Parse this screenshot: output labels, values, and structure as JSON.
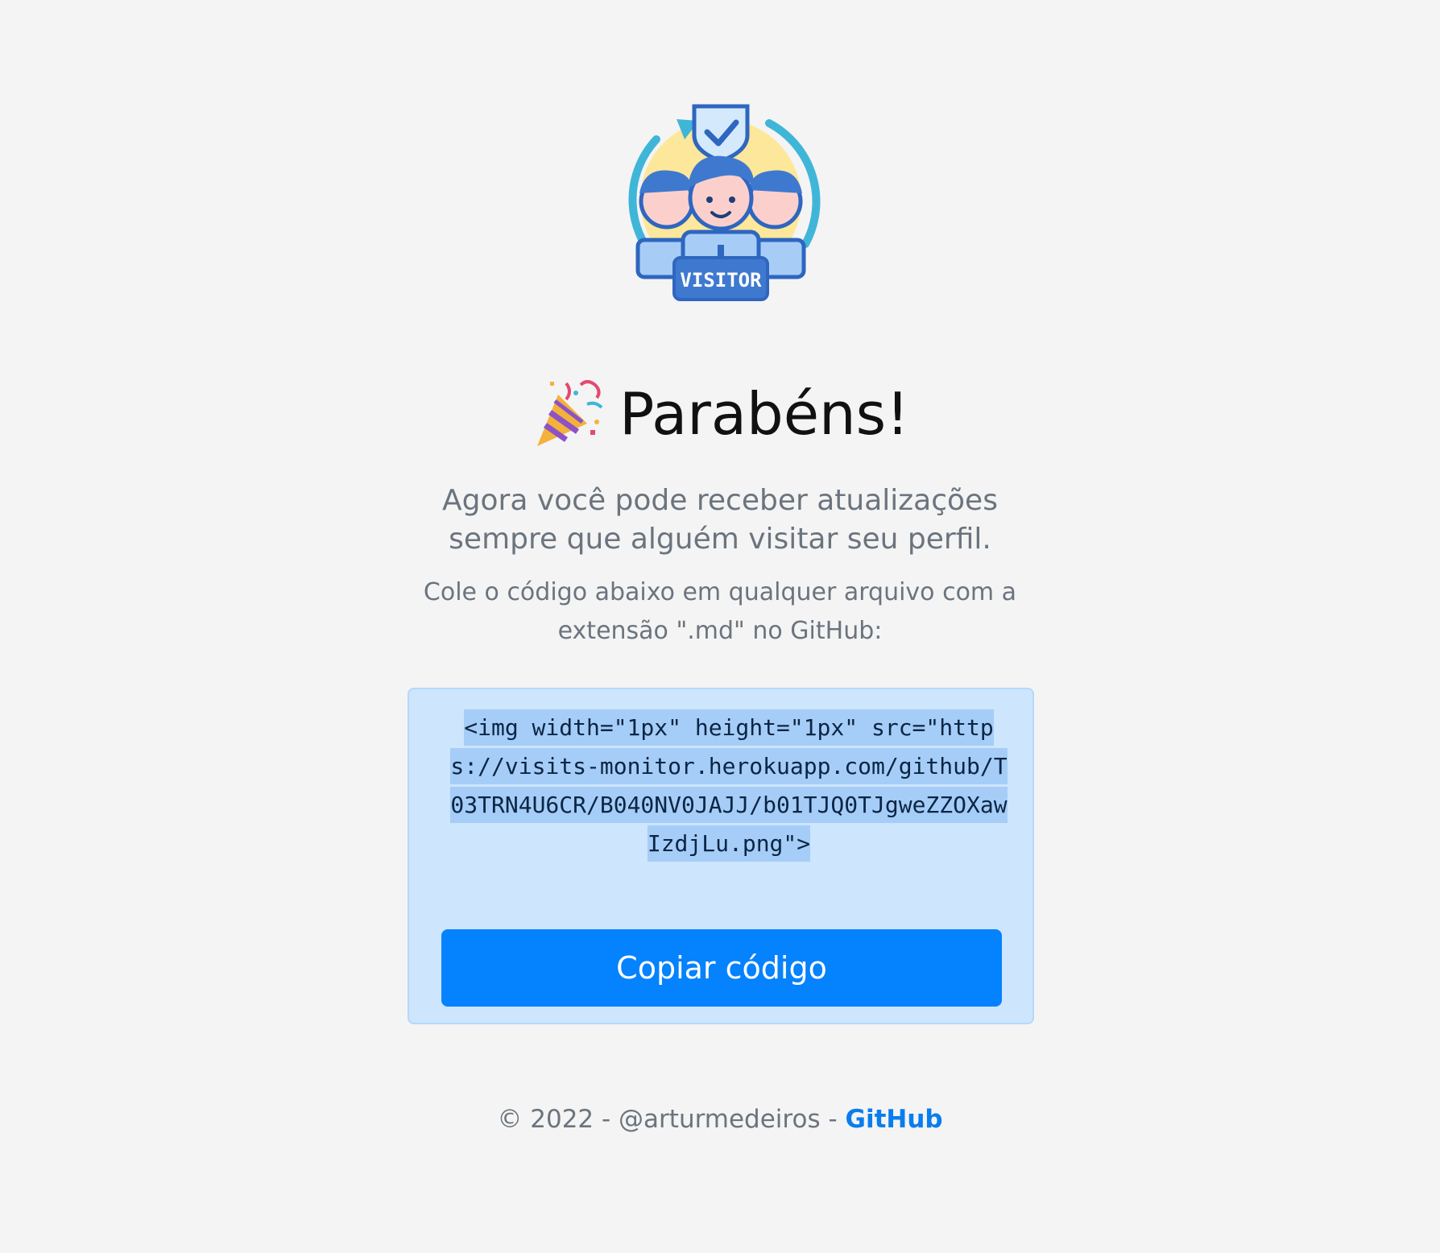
{
  "header": {
    "logo_icon": "visitor-badge-icon",
    "logo_badge_text": "VISITOR",
    "celebrate_icon": "party-popper-icon",
    "title": "Parabéns!"
  },
  "main": {
    "lead_line1": "Agora você pode receber atualizações",
    "lead_line2": "sempre que alguém visitar seu perfil.",
    "instruction_line1": "Cole o código abaixo em qualquer arquivo com a",
    "instruction_line2": "extensão \".md\" no GitHub:",
    "code_snippet": "<img width=\"1px\" height=\"1px\" src=\"https://visits-monitor.herokuapp.com/github/T03TRN4U6CR/B040NV0JAJJ/b01TJQ0TJgweZZOXawIzdjLu.png\">",
    "copy_button_label": "Copiar código"
  },
  "footer": {
    "copyright": "© 2022 - @arturmedeiros - ",
    "github_link_label": "GitHub"
  },
  "colors": {
    "background": "#f4f4f4",
    "accent": "#0582fd",
    "code_box_bg": "#cde5fd",
    "muted_text": "#6b747e"
  }
}
